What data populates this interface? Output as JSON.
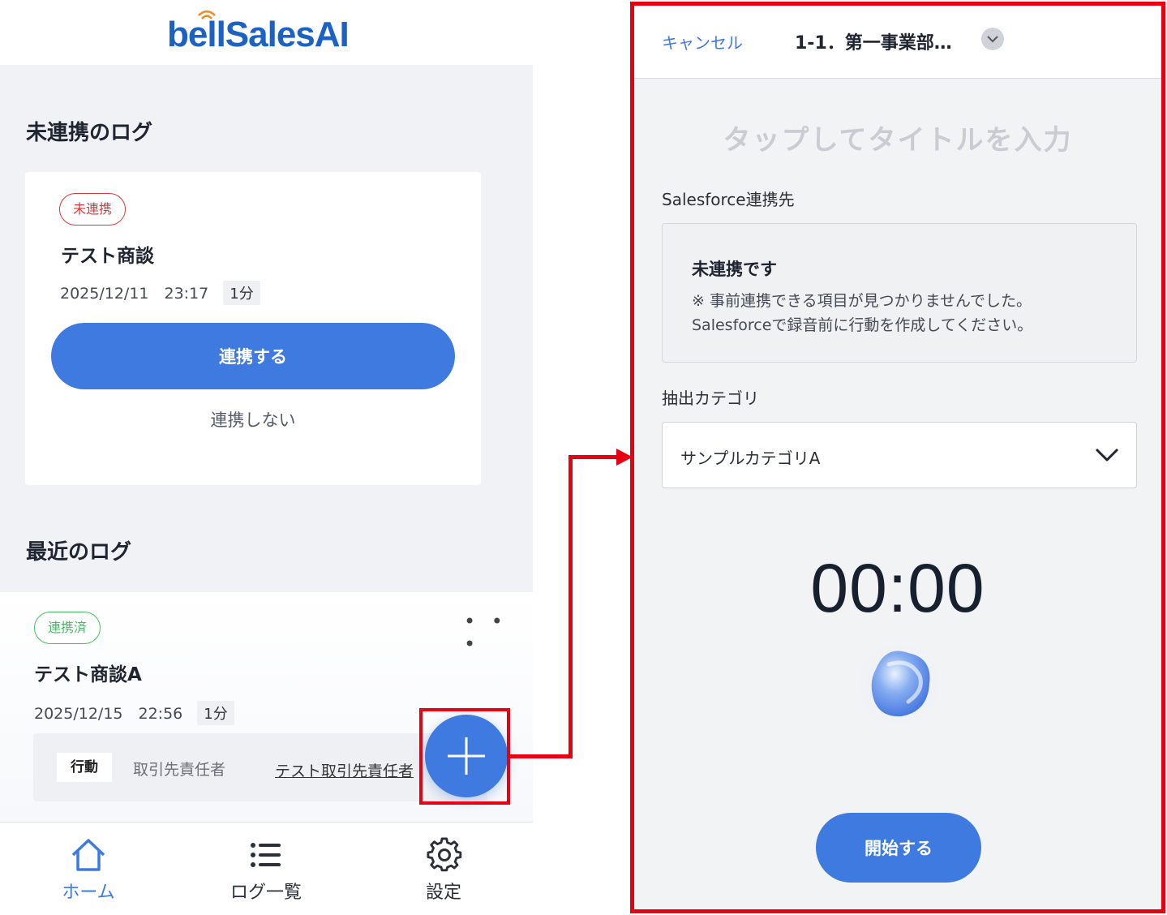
{
  "left": {
    "logo": "bellSalesAI",
    "unlinked_section_title": "未連携のログ",
    "unlinked_card": {
      "badge": "未連携",
      "title": "テスト商談",
      "datetime": "2025/12/11　23:17",
      "duration": "1分",
      "link_button": "連携する",
      "skip_link": "連携しない"
    },
    "recent_section_title": "最近のログ",
    "recent_card": {
      "badge": "連携済",
      "title": "テスト商談A",
      "datetime": "2025/12/15　22:56",
      "duration": "1分",
      "more": "• • •",
      "action_tag": "行動",
      "action_label": "取引先責任者",
      "action_link": "テスト取引先責任者"
    },
    "nav": {
      "home": "ホーム",
      "log_list": "ログ一覧",
      "settings": "設定"
    }
  },
  "right": {
    "cancel": "キャンセル",
    "department": "1-1．第一事業部…",
    "title_placeholder": "タップしてタイトルを入力",
    "salesforce_label": "Salesforce連携先",
    "salesforce_status_title": "未連携です",
    "salesforce_note_1": "※ 事前連携できる項目が見つかりませんでした。",
    "salesforce_note_2": "Salesforceで録音前に行動を作成してください。",
    "category_label": "抽出カテゴリ",
    "category_selected": "サンプルカテゴリA",
    "timer": "00:00",
    "start_button": "開始する"
  },
  "colors": {
    "primary": "#3f7ae0",
    "highlight": "#e60012",
    "unlinked_badge": "#d9383a",
    "linked_badge": "#3fbf62"
  },
  "icons": [
    "home-icon",
    "list-icon",
    "gear-icon",
    "plus-icon",
    "chevron-down-icon",
    "voice-orb-icon"
  ]
}
